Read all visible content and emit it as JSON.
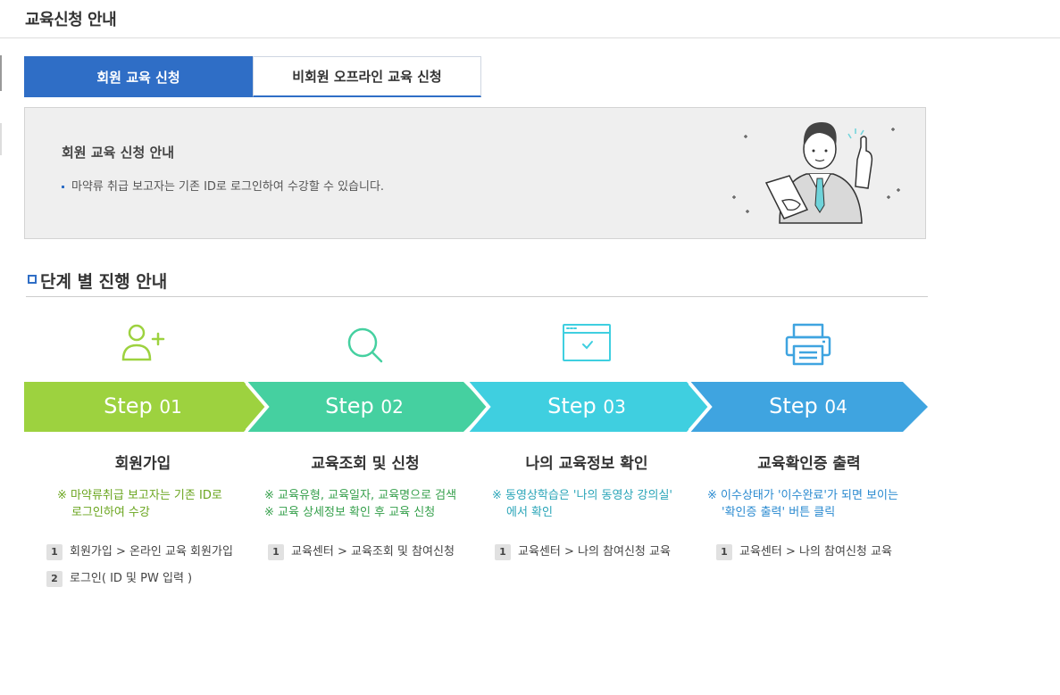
{
  "page": {
    "title": "교육신청 안내"
  },
  "tabs": [
    {
      "label": "회원 교육 신청",
      "active": true
    },
    {
      "label": "비회원 오프라인 교육 신청",
      "active": false
    }
  ],
  "info": {
    "title": "회원 교육 신청 안내",
    "bullet": "마약류 취급 보고자는 기존 ID로 로그인하여 수강할 수 있습니다."
  },
  "section": {
    "title": "단계 별 진행 안내"
  },
  "steps": [
    {
      "icon": "add-user-icon",
      "color": "#9dd23f",
      "step_word": "Step",
      "step_num": "01",
      "name": "회원가입",
      "note_color": "#6aa51e",
      "notes": [
        "※ 마약류취급 보고자는 기존 ID로",
        "로그인하여 수강"
      ],
      "paths": [
        {
          "n": "1",
          "text": "회원가입 > 온라인 교육 회원가입"
        },
        {
          "n": "2",
          "text": "로그인( ID 및 PW 입력 )"
        }
      ]
    },
    {
      "icon": "search-icon",
      "color": "#45d0a0",
      "step_word": "Step",
      "step_num": "02",
      "name": "교육조회 및 신청",
      "note_color": "#36a04c",
      "notes": [
        "※ 교육유형, 교육일자, 교육명으로 검색",
        "※ 교육 상세정보 확인 후 교육 신청"
      ],
      "paths": [
        {
          "n": "1",
          "text": "교육센터 > 교육조회 및 참여신청"
        }
      ]
    },
    {
      "icon": "browser-check-icon",
      "color": "#3fcfe0",
      "step_word": "Step",
      "step_num": "03",
      "name": "나의 교육정보 확인",
      "note_color": "#2aa5b8",
      "notes": [
        "※ 동영상학습은 '나의 동영상 강의실'",
        "에서 확인"
      ],
      "paths": [
        {
          "n": "1",
          "text": "교육센터 > 나의 참여신청 교육"
        }
      ]
    },
    {
      "icon": "printer-icon",
      "color": "#3fa4e0",
      "step_word": "Step",
      "step_num": "04",
      "name": "교육확인증 출력",
      "note_color": "#2a8ad0",
      "notes": [
        "※ 이수상태가 '이수완료'가 되면 보이는",
        "'확인증 출력' 버튼 클릭"
      ],
      "paths": [
        {
          "n": "1",
          "text": "교육센터 > 나의 참여신청 교육"
        }
      ]
    }
  ]
}
